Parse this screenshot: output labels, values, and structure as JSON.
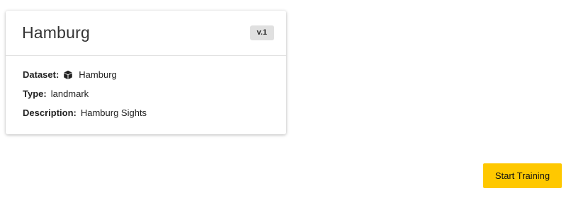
{
  "card": {
    "title": "Hamburg",
    "version": "v.1",
    "fields": {
      "dataset_label": "Dataset:",
      "dataset_value": "Hamburg",
      "dataset_icon": "cube-icon",
      "type_label": "Type:",
      "type_value": "landmark",
      "description_label": "Description:",
      "description_value": "Hamburg Sights"
    }
  },
  "actions": {
    "start_training_label": "Start Training"
  },
  "colors": {
    "accent": "#ffc800",
    "badge_bg": "#e0e0e0",
    "divider": "#e2e2e2"
  }
}
